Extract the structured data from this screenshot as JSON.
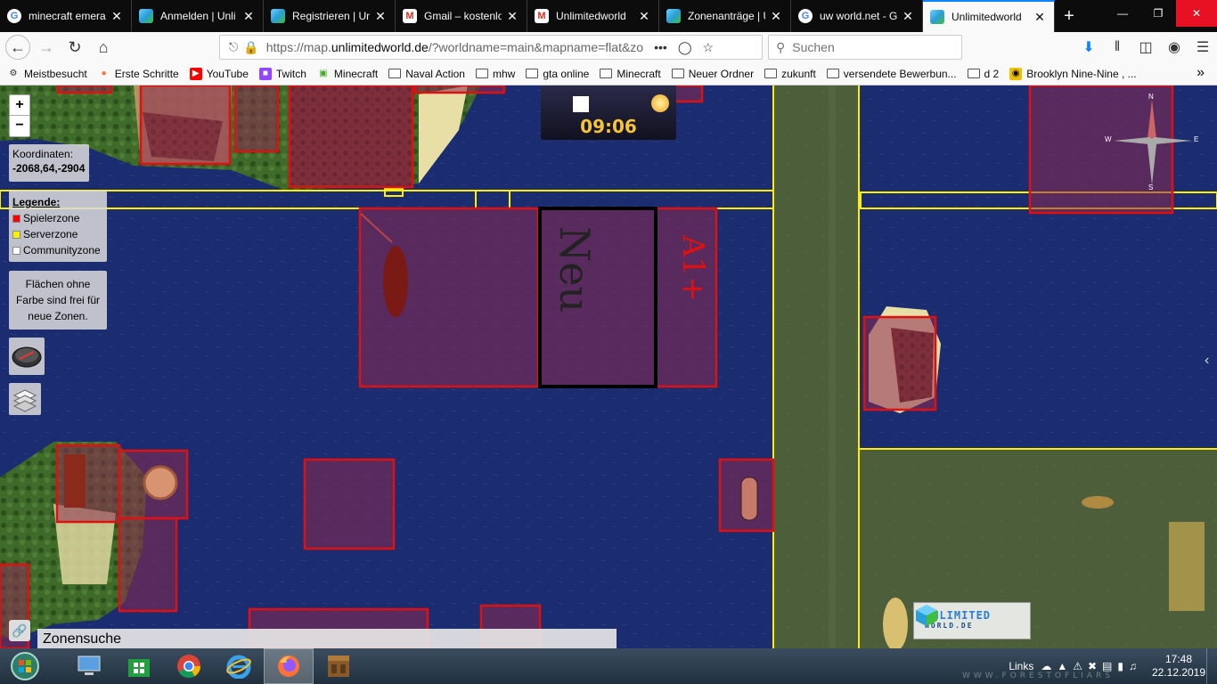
{
  "browser": {
    "tabs": [
      {
        "title": "minecraft emera",
        "favicon": "google-icon",
        "color": "#4285f4"
      },
      {
        "title": "Anmelden | Unli",
        "favicon": "uw-cube-icon",
        "color": "#2b9ed8"
      },
      {
        "title": "Registrieren | Unl",
        "favicon": "uw-cube-icon",
        "color": "#2b9ed8"
      },
      {
        "title": "Gmail – kostenlo",
        "favicon": "gmail-icon",
        "color": "#d93025"
      },
      {
        "title": "Unlimitedworld",
        "favicon": "gmail-icon",
        "color": "#d93025"
      },
      {
        "title": "Zonenanträge | U",
        "favicon": "uw-cube-icon",
        "color": "#2b9ed8"
      },
      {
        "title": "uw world.net - G",
        "favicon": "google-icon",
        "color": "#4285f4"
      },
      {
        "title": "Unlimitedworld",
        "favicon": "uw-cube-icon",
        "color": "#2b9ed8",
        "active": true
      }
    ],
    "url_prefix": "https://map.",
    "url_domain": "unlimitedworld.de",
    "url_rest": "/?worldname=main&mapname=flat&zo",
    "url_more": "•••",
    "search_placeholder": "Suchen"
  },
  "bookmarks": [
    {
      "label": "Meistbesucht",
      "icon": "gear-icon"
    },
    {
      "label": "Erste Schritte",
      "icon": "firefox-icon"
    },
    {
      "label": "YouTube",
      "icon": "youtube-icon"
    },
    {
      "label": "Twitch",
      "icon": "twitch-icon"
    },
    {
      "label": "Minecraft",
      "icon": "minecraft-icon"
    },
    {
      "label": "Naval Action",
      "icon": "folder-icon"
    },
    {
      "label": "mhw",
      "icon": "folder-icon"
    },
    {
      "label": "gta online",
      "icon": "folder-icon"
    },
    {
      "label": "Minecraft",
      "icon": "folder-icon"
    },
    {
      "label": "Neuer Ordner",
      "icon": "folder-icon"
    },
    {
      "label": "zukunft",
      "icon": "folder-icon"
    },
    {
      "label": "versendete Bewerbun...",
      "icon": "folder-icon"
    },
    {
      "label": "d 2",
      "icon": "folder-icon"
    },
    {
      "label": "Brooklyn Nine-Nine , ...",
      "icon": "b99-icon"
    }
  ],
  "bookmarks_overflow": "»",
  "map": {
    "zoom_in": "+",
    "zoom_out": "−",
    "coords_label": "Koordinaten:",
    "coords_value": "-2068,64,-2904",
    "legend_title": "Legende:",
    "legend_items": [
      {
        "label": "Spielerzone",
        "color": "#ff0000"
      },
      {
        "label": "Serverzone",
        "color": "#ffee00"
      },
      {
        "label": "Communityzone",
        "color": "#ffffff"
      }
    ],
    "free_note": "Flächen ohne Farbe sind frei für neue Zonen.",
    "time": "09:06",
    "search_label": "Zonensuche",
    "compass": {
      "n": "N",
      "e": "E",
      "s": "S",
      "w": "W"
    },
    "logo_text": "UNLIMITED",
    "logo_sub": "WORLD.DE",
    "scrawl_neu": "Neu",
    "scrawl_a1": "A1+"
  },
  "taskbar": {
    "links_label": "Links",
    "time": "17:48",
    "date": "22.12.2019",
    "watermark": "WWW.FORESTOFLIARS"
  }
}
